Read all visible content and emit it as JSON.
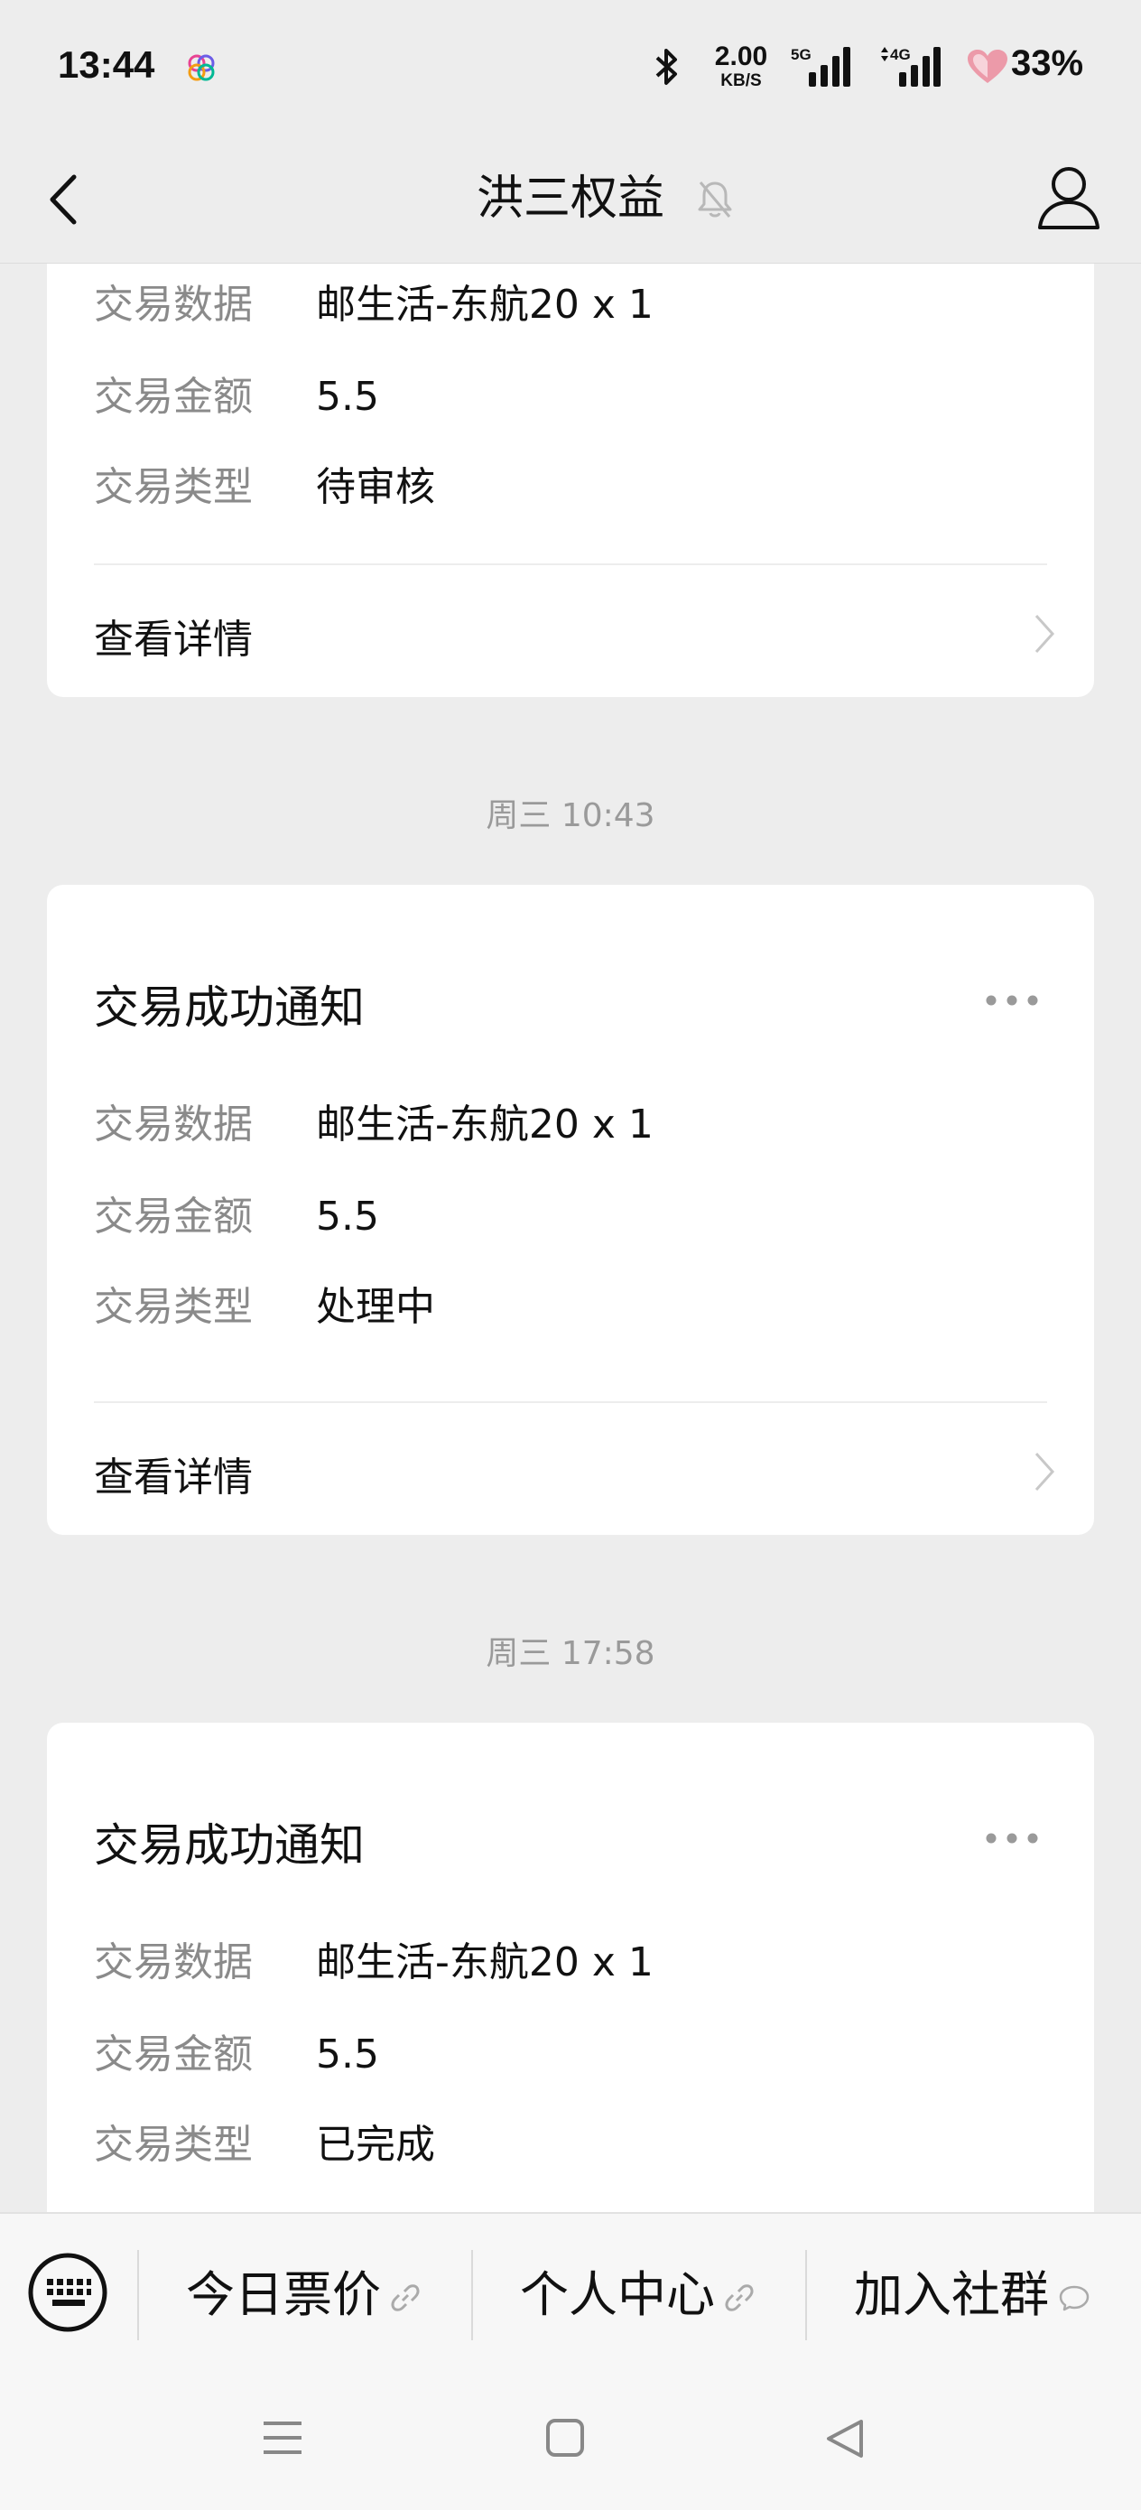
{
  "status_bar": {
    "time": "13:44",
    "net_speed_value": "2.00",
    "net_speed_unit": "KB/S",
    "signal1_label": "5G",
    "signal2_label": "4G",
    "battery": "33%"
  },
  "header": {
    "title": "洪三权益"
  },
  "messages": [
    {
      "rows": [
        {
          "label": "交易数据",
          "value": "邮生活-东航20 x 1"
        },
        {
          "label": "交易金额",
          "value": "5.5"
        },
        {
          "label": "交易类型",
          "value": "待审核"
        }
      ],
      "link": "查看详情"
    },
    {
      "timestamp": "周三 10:43",
      "title": "交易成功通知",
      "rows": [
        {
          "label": "交易数据",
          "value": "邮生活-东航20 x 1"
        },
        {
          "label": "交易金额",
          "value": "5.5"
        },
        {
          "label": "交易类型",
          "value": "处理中"
        }
      ],
      "link": "查看详情"
    },
    {
      "timestamp": "周三 17:58",
      "title": "交易成功通知",
      "rows": [
        {
          "label": "交易数据",
          "value": "邮生活-东航20 x 1"
        },
        {
          "label": "交易金额",
          "value": "5.5"
        },
        {
          "label": "交易类型",
          "value": "已完成"
        }
      ]
    }
  ],
  "menu": {
    "items": [
      {
        "label": "今日票价",
        "icon": "link-icon"
      },
      {
        "label": "个人中心",
        "icon": "link-icon"
      },
      {
        "label": "加入社群",
        "icon": "chat-bubble-icon"
      }
    ]
  }
}
